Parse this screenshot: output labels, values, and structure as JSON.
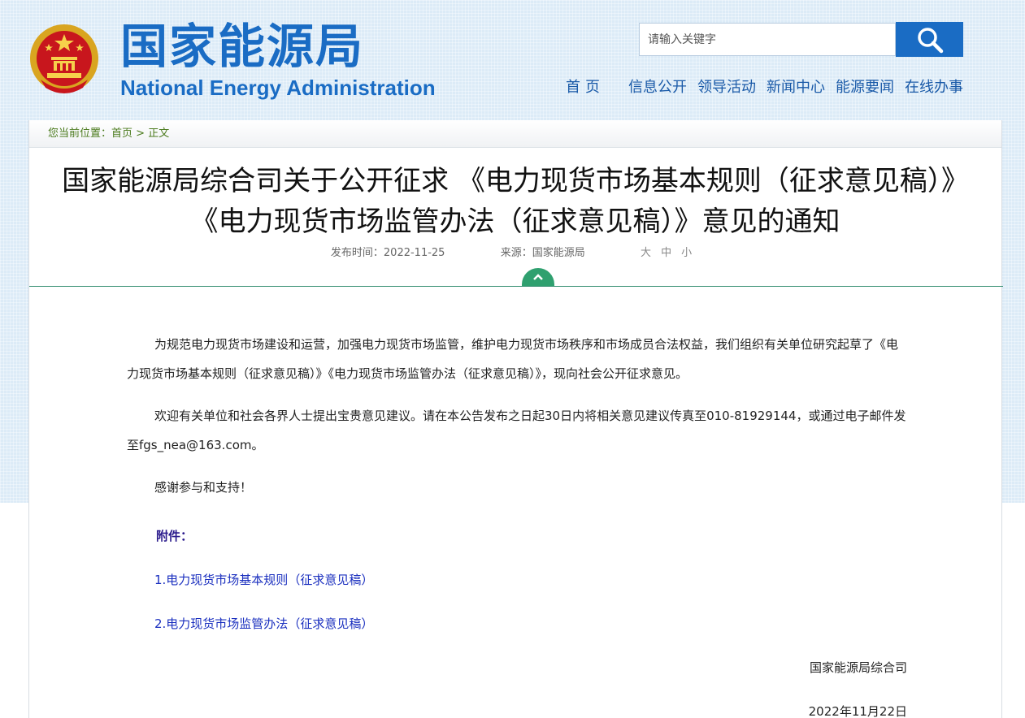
{
  "header": {
    "logo_cn": "国家能源局",
    "logo_en": "National Energy Administration",
    "search_placeholder": "请输入关键字"
  },
  "nav": {
    "items": [
      "首页",
      "信息公开",
      "领导活动",
      "新闻中心",
      "能源要闻",
      "在线办事"
    ]
  },
  "breadcrumb": {
    "prefix": "您当前位置：",
    "home": "首页",
    "separator": ">",
    "current": "正文"
  },
  "article": {
    "title": "国家能源局综合司关于公开征求 《电力现货市场基本规则（征求意见稿）》《电力现货市场监管办法（征求意见稿）》意见的通知",
    "publish_label": "发布时间：2022-11-25",
    "source_label": "来源：国家能源局",
    "font_sizes": [
      "大",
      "中",
      "小"
    ],
    "paragraphs": [
      "为规范电力现货市场建设和运营，加强电力现货市场监管，维护电力现货市场秩序和市场成员合法权益，我们组织有关单位研究起草了《电力现货市场基本规则（征求意见稿）》《电力现货市场监管办法（征求意见稿）》，现向社会公开征求意见。",
      "欢迎有关单位和社会各界人士提出宝贵意见建议。请在本公告发布之日起30日内将相关意见建议传真至010-81929144，或通过电子邮件发至fgs_nea@163.com。",
      "感谢参与和支持！"
    ],
    "attachments_label": "附件：",
    "attachments": [
      "1.电力现货市场基本规则（征求意见稿）",
      "2.电力现货市场监管办法（征求意见稿）"
    ],
    "signature": "国家能源局综合司",
    "date": "2022年11月22日"
  },
  "colors": {
    "brand_blue": "#1a6cc4",
    "accent_green": "#2fa06f",
    "link_blue": "#1a2fbf"
  }
}
